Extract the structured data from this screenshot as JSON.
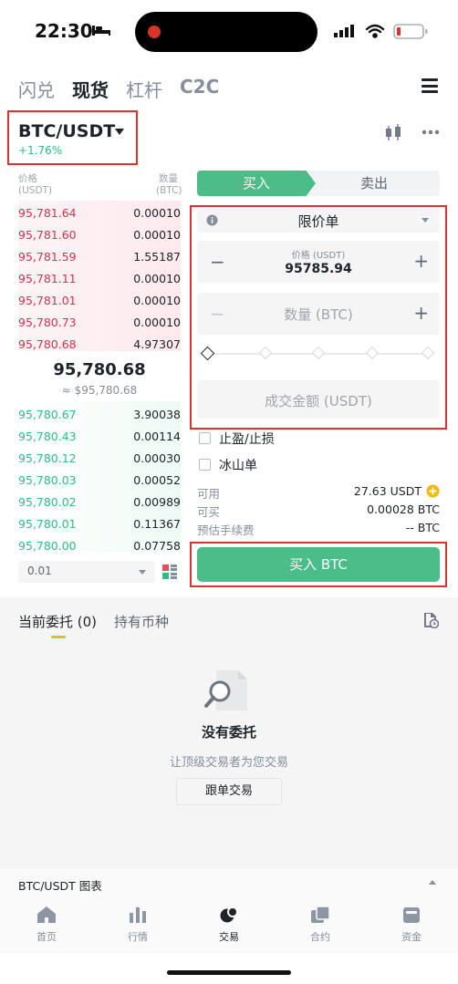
{
  "status_bar": {
    "time": "22:30"
  },
  "trade_types": [
    "闪兑",
    "现货",
    "杠杆",
    "C2C"
  ],
  "pair": {
    "name": "BTC/USDT",
    "change": "+1.76%"
  },
  "orderbook": {
    "price_header": "价格",
    "price_unit": "(USDT)",
    "qty_header": "数量",
    "qty_unit": "(BTC)",
    "asks": [
      {
        "price": "95,781.64",
        "qty": "0.00010"
      },
      {
        "price": "95,781.60",
        "qty": "0.00010"
      },
      {
        "price": "95,781.59",
        "qty": "1.55187"
      },
      {
        "price": "95,781.11",
        "qty": "0.00010"
      },
      {
        "price": "95,781.01",
        "qty": "0.00010"
      },
      {
        "price": "95,780.73",
        "qty": "0.00010"
      },
      {
        "price": "95,780.68",
        "qty": "4.97307"
      }
    ],
    "last_price": "95,780.68",
    "last_price_fiat": "≈ $95,780.68",
    "bids": [
      {
        "price": "95,780.67",
        "qty": "3.90038"
      },
      {
        "price": "95,780.43",
        "qty": "0.00114"
      },
      {
        "price": "95,780.12",
        "qty": "0.00030"
      },
      {
        "price": "95,780.03",
        "qty": "0.00052"
      },
      {
        "price": "95,780.02",
        "qty": "0.00989"
      },
      {
        "price": "95,780.01",
        "qty": "0.11367"
      },
      {
        "price": "95,780.00",
        "qty": "0.07758"
      }
    ],
    "precision": "0.01"
  },
  "order_form": {
    "buy_label": "买入",
    "sell_label": "卖出",
    "order_type": "限价单",
    "price_label": "价格 (USDT)",
    "price_value": "95785.94",
    "qty_placeholder": "数量 (BTC)",
    "total_placeholder": "成交金额 (USDT)",
    "tp_sl_label": "止盈/止损",
    "iceberg_label": "冰山单",
    "available_label": "可用",
    "available_value": "27.63 USDT",
    "can_buy_label": "可买",
    "can_buy_value": "0.00028 BTC",
    "fee_label": "预估手续费",
    "fee_value": "-- BTC",
    "submit_label": "买入 BTC"
  },
  "orders": {
    "tab_open": "当前委托 (0)",
    "tab_holdings": "持有币种",
    "empty_title": "没有委托",
    "empty_subtitle": "让顶级交易者为您交易",
    "copy_button": "跟单交易"
  },
  "chart_bar": {
    "label": "BTC/USDT 图表"
  },
  "nav": [
    {
      "label": "首页",
      "icon": "home-icon"
    },
    {
      "label": "行情",
      "icon": "market-icon"
    },
    {
      "label": "交易",
      "icon": "trade-icon"
    },
    {
      "label": "合约",
      "icon": "futures-icon"
    },
    {
      "label": "资金",
      "icon": "wallet-icon"
    }
  ],
  "colors": {
    "green": "#4bbd88",
    "red": "#d9304f",
    "highlight": "#e03131"
  }
}
